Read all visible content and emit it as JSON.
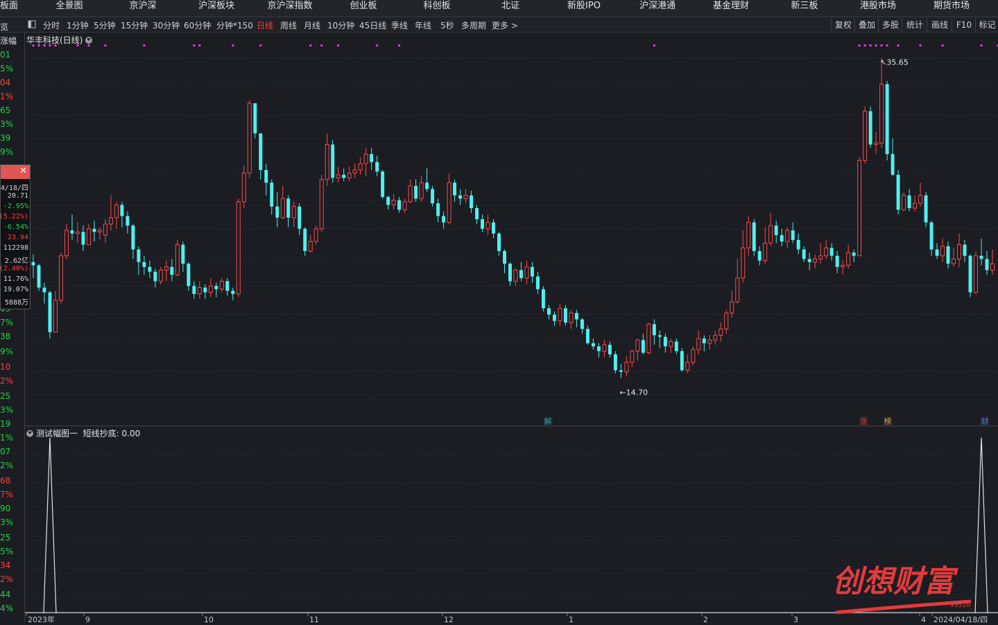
{
  "nav": {
    "items": [
      "板面",
      "全景图",
      "京沪深",
      "沪深板块",
      "京沪深指数",
      "创业板",
      "科创板",
      "北证",
      "新股IPO",
      "沪深港通",
      "基金理财",
      "新三板",
      "港股市场",
      "期货市场"
    ]
  },
  "toolbar": {
    "periods": [
      "分时",
      "1分钟",
      "5分钟",
      "15分钟",
      "30分钟",
      "60分钟",
      "分钟*150",
      "日线",
      "周线",
      "月线",
      "10分钟",
      "45日线",
      "季线",
      "年线",
      "5秒",
      "多周期",
      "更多 >"
    ],
    "active": "日线",
    "right_buttons": [
      "复权",
      "叠加",
      "多股",
      "统计",
      "画线",
      "F10",
      "标记"
    ]
  },
  "stock": {
    "title": "华丰科技(日线)",
    "high_label": "35.65",
    "low_label": "14.70"
  },
  "left_axis": [
    {
      "t": "览",
      "c": "w"
    },
    {
      "t": "涨幅",
      "c": "w"
    },
    {
      "t": "01",
      "c": "g"
    },
    {
      "t": "5%",
      "c": "g"
    },
    {
      "t": "04",
      "c": "r"
    },
    {
      "t": "1%",
      "c": "r"
    },
    {
      "t": "65",
      "c": "g"
    },
    {
      "t": "3%",
      "c": "g"
    },
    {
      "t": "39",
      "c": "g"
    },
    {
      "t": "9%",
      "c": "g"
    },
    {
      "t": "09",
      "c": "g"
    },
    {
      "t": "7%",
      "c": "g"
    },
    {
      "t": "38",
      "c": "g"
    },
    {
      "t": "9%",
      "c": "g"
    },
    {
      "t": "10",
      "c": "r"
    },
    {
      "t": "2%",
      "c": "r"
    },
    {
      "t": "25",
      "c": "g"
    },
    {
      "t": "3%",
      "c": "g"
    },
    {
      "t": "19",
      "c": "g"
    },
    {
      "t": "1%",
      "c": "g"
    },
    {
      "t": "07",
      "c": "g"
    },
    {
      "t": "2%",
      "c": "g"
    },
    {
      "t": "68",
      "c": "r"
    },
    {
      "t": "7%",
      "c": "r"
    },
    {
      "t": "90",
      "c": "g"
    },
    {
      "t": "3%",
      "c": "g"
    },
    {
      "t": "25",
      "c": "g"
    },
    {
      "t": "5%",
      "c": "g"
    },
    {
      "t": "34",
      "c": "r"
    },
    {
      "t": "2%",
      "c": "r"
    },
    {
      "t": "44",
      "c": "g"
    },
    {
      "t": "4%",
      "c": "g"
    }
  ],
  "tooltip": [
    {
      "t": "4/18/四",
      "c": "w"
    },
    {
      "t": "20.71",
      "c": "w"
    },
    {
      "t": "-2.95%",
      "c": "g"
    },
    {
      "t": "(5.22%)",
      "c": "r"
    },
    {
      "t": "-6.54%",
      "c": "g"
    },
    {
      "t": "23.94",
      "c": "r"
    },
    {
      "t": "112298",
      "c": "w"
    },
    {
      "t": "2.62亿",
      "c": "w"
    },
    {
      "t": "(2.40%)",
      "c": "r"
    },
    {
      "t": "11.76%",
      "c": "w"
    },
    {
      "t": "19.07%",
      "c": "w"
    },
    {
      "t": "5888万",
      "c": "w"
    }
  ],
  "markers": [
    "解",
    "涨",
    "榜",
    "财"
  ],
  "indicator": {
    "title": "测试幅图一",
    "label": "短线抄底:",
    "value": "0.00"
  },
  "x_axis": [
    "2023年",
    "9",
    "10",
    "11",
    "12",
    "1",
    "2",
    "3",
    "4",
    "2024/04/18/四"
  ],
  "watermark": {
    "text": "创想财富",
    "url": "995168.cn"
  },
  "colors": {
    "up": "#ff4a4a",
    "down": "#4ff0f0",
    "bg": "#1b1d22",
    "grid": "#33363c",
    "accent": "#e23b3b"
  },
  "chart_data": {
    "type": "candlestick",
    "price_range": [
      13.5,
      36.5
    ],
    "high": 35.65,
    "low": 14.7,
    "candles": [
      [
        22.8,
        22.6,
        23.3,
        21.8
      ],
      [
        22.6,
        21.2,
        22.7,
        21.0
      ],
      [
        21.2,
        20.9,
        21.5,
        20.2
      ],
      [
        20.9,
        18.4,
        21.0,
        18.0
      ],
      [
        18.4,
        20.4,
        21.0,
        19.5
      ],
      [
        20.4,
        23.2,
        23.4,
        20.2
      ],
      [
        23.2,
        24.8,
        25.2,
        23.0
      ],
      [
        24.8,
        24.6,
        25.8,
        24.2
      ],
      [
        24.6,
        24.7,
        25.3,
        24.0
      ],
      [
        24.7,
        23.9,
        25.1,
        23.5
      ],
      [
        23.9,
        24.9,
        25.2,
        23.9
      ],
      [
        24.9,
        24.7,
        25.4,
        24.1
      ],
      [
        24.7,
        24.8,
        25.0,
        24.2
      ],
      [
        24.5,
        25.2,
        25.5,
        24.0
      ],
      [
        25.2,
        25.6,
        27.0,
        24.8
      ],
      [
        25.6,
        26.4,
        26.6,
        24.9
      ],
      [
        26.4,
        25.7,
        26.6,
        25.0
      ],
      [
        25.7,
        25.1,
        26.0,
        24.6
      ],
      [
        25.1,
        23.6,
        25.2,
        23.0
      ],
      [
        23.6,
        22.8,
        23.8,
        22.0
      ],
      [
        22.8,
        22.5,
        23.2,
        22.0
      ],
      [
        22.5,
        22.2,
        22.9,
        21.8
      ],
      [
        22.2,
        21.6,
        22.4,
        21.2
      ],
      [
        21.6,
        22.3,
        22.5,
        21.4
      ],
      [
        22.3,
        22.5,
        22.9,
        21.6
      ],
      [
        22.5,
        22.0,
        23.0,
        21.6
      ],
      [
        22.0,
        23.9,
        24.2,
        21.9
      ],
      [
        23.9,
        22.7,
        24.1,
        22.2
      ],
      [
        22.7,
        21.3,
        22.8,
        21.0
      ],
      [
        21.3,
        20.8,
        21.6,
        20.5
      ],
      [
        20.8,
        21.2,
        21.6,
        20.5
      ],
      [
        21.2,
        20.9,
        21.4,
        20.5
      ],
      [
        20.9,
        21.3,
        21.8,
        20.6
      ],
      [
        21.3,
        21.1,
        21.5,
        20.6
      ],
      [
        21.1,
        21.6,
        21.8,
        20.9
      ],
      [
        21.6,
        21.0,
        21.8,
        20.7
      ],
      [
        21.0,
        20.8,
        21.2,
        20.4
      ],
      [
        20.8,
        26.6,
        26.8,
        20.6
      ],
      [
        26.6,
        28.4,
        28.9,
        26.2
      ],
      [
        28.4,
        32.8,
        33.0,
        28.1
      ],
      [
        32.8,
        30.9,
        31.5,
        30.6
      ],
      [
        30.9,
        28.6,
        30.9,
        28.0
      ],
      [
        28.6,
        27.8,
        29.0,
        27.0
      ],
      [
        27.8,
        26.3,
        28.0,
        25.8
      ],
      [
        26.3,
        25.6,
        27.2,
        25.0
      ],
      [
        25.6,
        26.8,
        27.6,
        25.5
      ],
      [
        26.8,
        25.6,
        27.0,
        25.0
      ],
      [
        25.6,
        26.3,
        26.6,
        25.0
      ],
      [
        26.3,
        24.9,
        26.5,
        24.5
      ],
      [
        24.9,
        23.5,
        25.0,
        23.2
      ],
      [
        23.5,
        24.1,
        24.5,
        23.4
      ],
      [
        24.1,
        24.9,
        25.1,
        23.9
      ],
      [
        24.9,
        28.0,
        28.3,
        24.7
      ],
      [
        28.0,
        30.2,
        30.9,
        27.6
      ],
      [
        30.2,
        28.1,
        30.5,
        27.8
      ],
      [
        28.1,
        28.3,
        28.8,
        27.8
      ],
      [
        28.3,
        28.1,
        28.7,
        27.9
      ],
      [
        28.1,
        28.4,
        28.8,
        27.9
      ],
      [
        28.4,
        28.6,
        29.0,
        28.1
      ],
      [
        28.6,
        29.0,
        29.4,
        28.3
      ],
      [
        29.0,
        29.6,
        30.0,
        28.2
      ],
      [
        29.6,
        29.1,
        30.0,
        28.6
      ],
      [
        29.1,
        28.5,
        29.5,
        28.2
      ],
      [
        28.5,
        26.9,
        28.6,
        26.8
      ],
      [
        26.9,
        26.4,
        27.0,
        26.1
      ],
      [
        26.4,
        26.7,
        27.1,
        26.1
      ],
      [
        26.7,
        26.1,
        26.9,
        25.9
      ],
      [
        26.1,
        26.6,
        26.8,
        25.9
      ],
      [
        26.6,
        27.6,
        28.0,
        26.5
      ],
      [
        27.6,
        26.8,
        28.0,
        26.6
      ],
      [
        26.8,
        27.8,
        28.2,
        26.6
      ],
      [
        27.8,
        27.4,
        28.7,
        27.2
      ],
      [
        27.4,
        26.5,
        27.6,
        26.3
      ],
      [
        26.5,
        25.7,
        26.8,
        25.3
      ],
      [
        25.7,
        25.3,
        26.0,
        24.9
      ],
      [
        25.3,
        27.8,
        28.4,
        25.2
      ],
      [
        27.8,
        27.0,
        28.0,
        26.6
      ],
      [
        27.0,
        26.8,
        27.4,
        26.4
      ],
      [
        26.8,
        27.0,
        27.4,
        26.5
      ],
      [
        27.0,
        26.2,
        27.3,
        25.9
      ],
      [
        26.2,
        25.5,
        26.4,
        25.2
      ],
      [
        25.5,
        24.9,
        25.8,
        24.7
      ],
      [
        24.9,
        25.3,
        25.8,
        24.5
      ],
      [
        25.3,
        24.6,
        25.5,
        24.3
      ],
      [
        24.6,
        23.5,
        24.7,
        23.2
      ],
      [
        23.5,
        22.7,
        23.6,
        22.1
      ],
      [
        22.7,
        21.6,
        22.8,
        21.3
      ],
      [
        21.6,
        22.3,
        22.4,
        21.3
      ],
      [
        22.3,
        21.8,
        22.8,
        21.6
      ],
      [
        21.8,
        22.5,
        22.9,
        21.4
      ],
      [
        22.5,
        21.9,
        22.8,
        21.5
      ],
      [
        21.9,
        21.1,
        22.2,
        20.8
      ],
      [
        21.1,
        19.9,
        21.3,
        19.7
      ],
      [
        19.9,
        19.5,
        20.1,
        19.2
      ],
      [
        19.5,
        19.1,
        19.7,
        18.8
      ],
      [
        19.1,
        19.9,
        20.2,
        18.8
      ],
      [
        19.9,
        19.0,
        20.1,
        18.8
      ],
      [
        19.0,
        19.6,
        19.8,
        18.6
      ],
      [
        19.6,
        19.2,
        19.8,
        18.7
      ],
      [
        19.2,
        18.6,
        19.3,
        18.3
      ],
      [
        18.6,
        17.7,
        18.8,
        17.6
      ],
      [
        17.7,
        17.5,
        18.0,
        17.3
      ],
      [
        17.5,
        17.2,
        17.7,
        16.8
      ],
      [
        17.2,
        17.6,
        17.9,
        16.8
      ],
      [
        17.6,
        17.0,
        17.8,
        16.8
      ],
      [
        17.0,
        16.0,
        17.2,
        15.8
      ],
      [
        16.0,
        15.9,
        16.4,
        15.5
      ],
      [
        15.9,
        16.5,
        16.9,
        15.6
      ],
      [
        16.5,
        17.2,
        17.3,
        16.2
      ],
      [
        17.2,
        17.9,
        18.0,
        16.6
      ],
      [
        17.9,
        17.1,
        18.3,
        17.0
      ],
      [
        17.1,
        18.9,
        19.0,
        17.0
      ],
      [
        18.9,
        18.2,
        19.2,
        17.6
      ],
      [
        18.2,
        18.1,
        18.5,
        17.4
      ],
      [
        18.1,
        17.5,
        18.3,
        17.1
      ],
      [
        17.5,
        17.8,
        18.0,
        17.1
      ],
      [
        17.8,
        17.2,
        18.0,
        17.0
      ],
      [
        17.2,
        16.0,
        17.4,
        15.9
      ],
      [
        16.0,
        16.5,
        17.0,
        15.8
      ],
      [
        16.5,
        17.3,
        17.5,
        16.3
      ],
      [
        17.3,
        18.0,
        18.5,
        17.0
      ],
      [
        18.0,
        17.7,
        18.2,
        17.2
      ],
      [
        17.7,
        17.9,
        18.2,
        17.3
      ],
      [
        17.9,
        18.2,
        18.5,
        17.6
      ],
      [
        18.2,
        18.6,
        19.0,
        17.8
      ],
      [
        18.6,
        19.6,
        19.8,
        18.3
      ],
      [
        19.6,
        20.3,
        21.0,
        19.3
      ],
      [
        20.3,
        21.8,
        23.0,
        20.2
      ],
      [
        21.8,
        23.7,
        24.8,
        21.5
      ],
      [
        23.7,
        25.3,
        25.7,
        23.2
      ],
      [
        25.3,
        23.5,
        25.5,
        23.2
      ],
      [
        23.5,
        22.9,
        23.8,
        22.6
      ],
      [
        22.9,
        24.0,
        25.0,
        22.7
      ],
      [
        24.0,
        25.1,
        25.9,
        23.8
      ],
      [
        25.1,
        24.5,
        25.4,
        24.0
      ],
      [
        24.5,
        24.1,
        24.9,
        23.8
      ],
      [
        24.1,
        24.8,
        25.0,
        23.7
      ],
      [
        24.8,
        24.2,
        25.3,
        24.0
      ],
      [
        24.2,
        23.6,
        24.6,
        23.3
      ],
      [
        23.6,
        23.0,
        23.8,
        22.8
      ],
      [
        23.0,
        22.8,
        23.4,
        22.3
      ],
      [
        22.8,
        23.0,
        23.3,
        22.4
      ],
      [
        23.0,
        23.2,
        24.0,
        22.7
      ],
      [
        23.2,
        23.7,
        24.2,
        23.0
      ],
      [
        23.7,
        23.2,
        24.0,
        22.9
      ],
      [
        23.2,
        22.5,
        23.5,
        22.1
      ],
      [
        22.5,
        22.6,
        22.9,
        22.0
      ],
      [
        22.6,
        23.4,
        23.9,
        22.4
      ],
      [
        23.4,
        23.2,
        23.6,
        22.8
      ],
      [
        23.2,
        29.2,
        29.4,
        23.2
      ],
      [
        29.2,
        32.3,
        32.6,
        29.0
      ],
      [
        32.3,
        30.2,
        32.6,
        30.0
      ],
      [
        30.2,
        30.3,
        31.0,
        29.6
      ],
      [
        30.3,
        34.0,
        35.65,
        30.0
      ],
      [
        34.0,
        29.6,
        34.2,
        29.2
      ],
      [
        29.6,
        28.3,
        30.6,
        28.2
      ],
      [
        28.3,
        26.1,
        28.6,
        25.8
      ],
      [
        26.1,
        27.0,
        27.2,
        26.0
      ],
      [
        27.0,
        26.2,
        27.4,
        26.0
      ],
      [
        26.2,
        26.5,
        27.0,
        26.0
      ],
      [
        26.5,
        27.0,
        27.8,
        26.3
      ],
      [
        27.0,
        25.3,
        27.2,
        25.0
      ],
      [
        25.3,
        23.6,
        25.4,
        23.2
      ],
      [
        23.6,
        23.2,
        24.0,
        23.0
      ],
      [
        23.2,
        23.8,
        24.3,
        22.8
      ],
      [
        23.8,
        22.7,
        24.1,
        22.4
      ],
      [
        22.7,
        23.0,
        23.7,
        22.5
      ],
      [
        23.0,
        23.9,
        24.6,
        22.5
      ],
      [
        23.9,
        23.2,
        24.2,
        22.8
      ],
      [
        23.2,
        20.9,
        23.3,
        20.6
      ],
      [
        20.9,
        23.2,
        23.5,
        20.8
      ],
      [
        23.2,
        23.0,
        24.3,
        22.6
      ],
      [
        23.0,
        22.3,
        23.5,
        22.0
      ],
      [
        22.3,
        22.7,
        23.6,
        22.0
      ]
    ],
    "magenta_signal_indices": [
      0,
      1,
      2,
      3,
      4,
      8,
      10,
      13,
      20,
      29,
      30,
      36,
      41,
      50,
      52,
      55,
      62,
      66,
      112,
      149,
      150,
      151,
      152,
      153,
      154,
      156,
      160,
      164,
      171,
      174
    ],
    "indicator_series": {
      "name": "短线抄底",
      "peaks_at": [
        3,
        171
      ],
      "value": 0.0
    }
  }
}
